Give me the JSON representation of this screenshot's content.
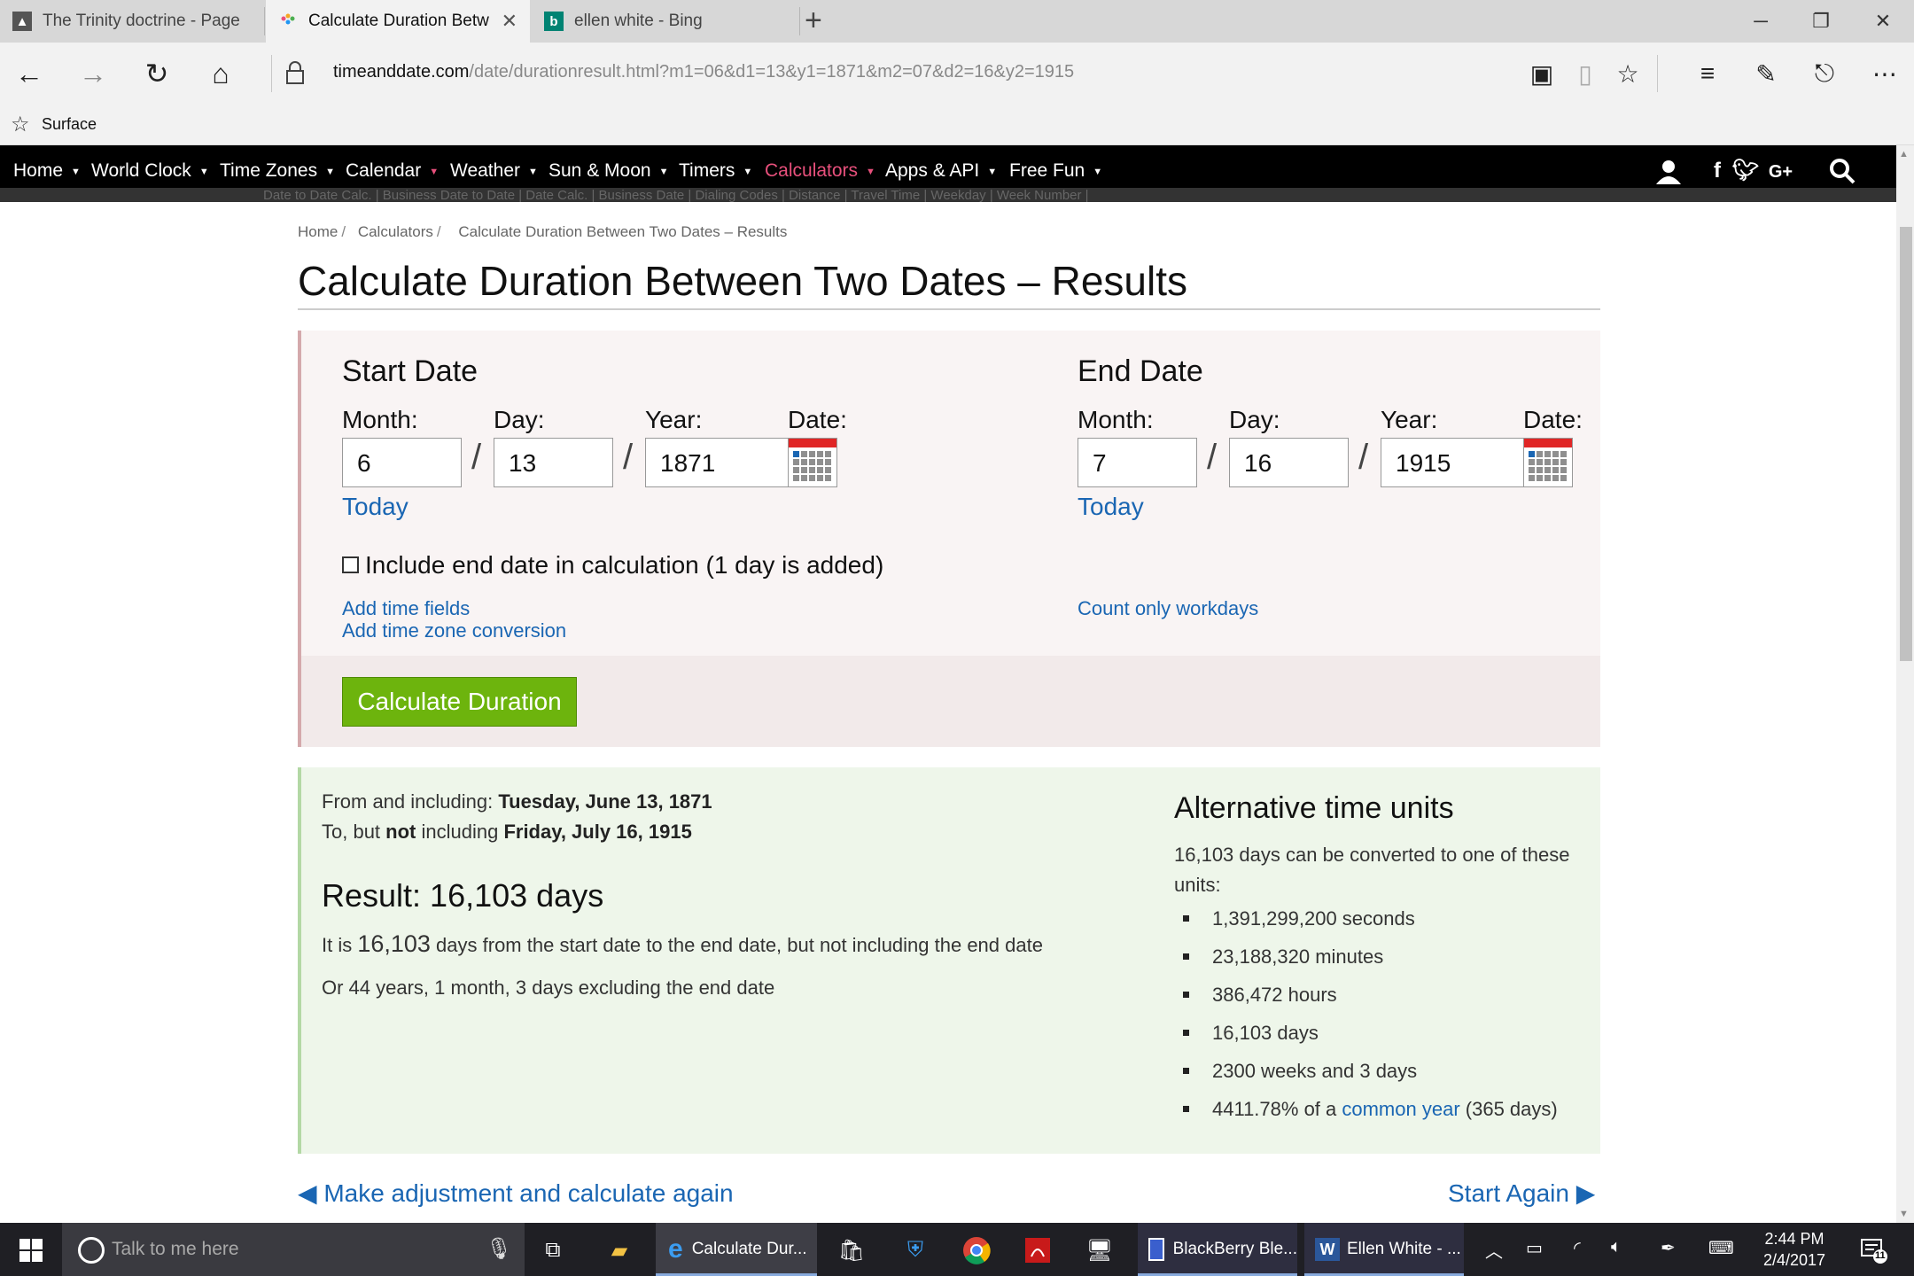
{
  "browser": {
    "tabs": [
      {
        "label": "The Trinity doctrine - Page ",
        "active": false
      },
      {
        "label": "Calculate Duration Betw",
        "active": true
      },
      {
        "label": "ellen white - Bing",
        "active": false
      }
    ],
    "url_host": "timeanddate.com",
    "url_path": "/date/durationresult.html?m1=06&d1=13&y1=1871&m2=07&d2=16&y2=1915",
    "favorites_item": "Surface"
  },
  "site_nav": {
    "items": [
      {
        "label": "Home"
      },
      {
        "label": "World Clock"
      },
      {
        "label": "Time Zones"
      },
      {
        "label": "Calendar"
      },
      {
        "label": "Weather"
      },
      {
        "label": "Sun & Moon"
      },
      {
        "label": "Timers"
      },
      {
        "label": "Calculators"
      },
      {
        "label": "Apps & API"
      },
      {
        "label": "Free Fun"
      }
    ],
    "active_color": "#e8507c",
    "subnav_text": "Date to Date Calc.  |  Business Date to Date  |  Date Calc.  |  Business Date  |  Dialing Codes  |  Distance  |  Travel Time  |  Weekday  |  Week Number  |"
  },
  "breadcrumb": [
    "Home",
    "Calculators",
    "Calculate Duration Between Two Dates – Results"
  ],
  "page_title": "Calculate Duration Between Two Dates – Results",
  "form": {
    "start": {
      "heading": "Start Date",
      "month_label": "Month:",
      "day_label": "Day:",
      "year_label": "Year:",
      "date_label": "Date:",
      "month": "6",
      "day": "13",
      "year": "1871",
      "today": "Today"
    },
    "end": {
      "heading": "End Date",
      "month_label": "Month:",
      "day_label": "Day:",
      "year_label": "Year:",
      "date_label": "Date:",
      "month": "7",
      "day": "16",
      "year": "1915",
      "today": "Today"
    },
    "include_end_label": "Include end date in calculation (1 day is added)",
    "add_time_fields": "Add time fields",
    "add_time_zone": "Add time zone conversion",
    "count_workdays": "Count only workdays",
    "calculate_button": "Calculate Duration",
    "button_color": "#6db40d"
  },
  "result": {
    "from_prefix": "From and including: ",
    "from_date": "Tuesday, June 13, 1871",
    "to_prefix": "To, but ",
    "to_not": "not",
    "to_mid": " including ",
    "to_date": "Friday, July 16, 1915",
    "heading": "Result: 16,103 days",
    "line1_prefix": "It is ",
    "line1_number": "16,103",
    "line1_suffix": " days from the start date to the end date, but not including the end date",
    "line2": "Or 44 years, 1 month, 3 days excluding the end date",
    "alt_heading": "Alternative time units",
    "alt_desc": "16,103 days can be converted to one of these units:",
    "alt_units": [
      "1,391,299,200 seconds",
      "23,188,320 minutes",
      "386,472 hours",
      "16,103 days",
      "2300 weeks and 3 days"
    ],
    "alt_last_prefix": "4411.78% of a ",
    "alt_last_link": "common year",
    "alt_last_suffix": " (365 days)"
  },
  "bottom": {
    "adjust": "◀ Make adjustment and calculate again",
    "start_again": "Start Again ▶"
  },
  "taskbar": {
    "search_placeholder": "Talk to me here",
    "apps": [
      {
        "label": "Calculate Dur..."
      },
      {
        "label": "BlackBerry Ble..."
      },
      {
        "label": "Ellen White - ..."
      }
    ],
    "time": "2:44 PM",
    "date": "2/4/2017",
    "notification_count": "11"
  }
}
